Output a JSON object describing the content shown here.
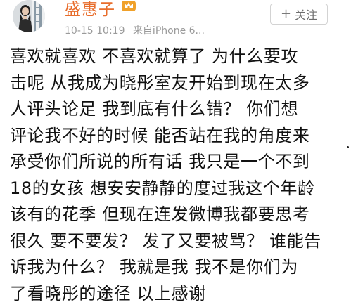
{
  "post": {
    "author": {
      "name": "盛惠子",
      "avatar_icon": "user-avatar-photo",
      "badge_icon": "crown-badge-icon"
    },
    "meta": {
      "timestamp": "10-15 10:19",
      "source": "来自iPhone 6..."
    },
    "follow_button": {
      "plus": "+",
      "label": "关注"
    },
    "content_lines": [
      "喜欢就喜欢  不喜欢就算了  为什么要攻",
      "击呢  从我成为晓彤室友开始到现在太多",
      "人评头论足  我到底有什么错？  你们想",
      "评论我不好的时候  能否站在我的角度来",
      "承受你们所说的所有话  我只是一个不到",
      "18的女孩  想安安静静的度过我这个年龄",
      "该有的花季  但现在连发微博我都要思考",
      "很久  要不要发？  发了又要被骂？  谁能告",
      "诉我为什么？  我就是我  我不是你们为",
      "了看晓彤的途径  以上感谢"
    ],
    "colors": {
      "username": "#e86d2c",
      "meta": "#9a9a9a",
      "text": "#111111",
      "button_border": "#d3d3d3"
    }
  }
}
